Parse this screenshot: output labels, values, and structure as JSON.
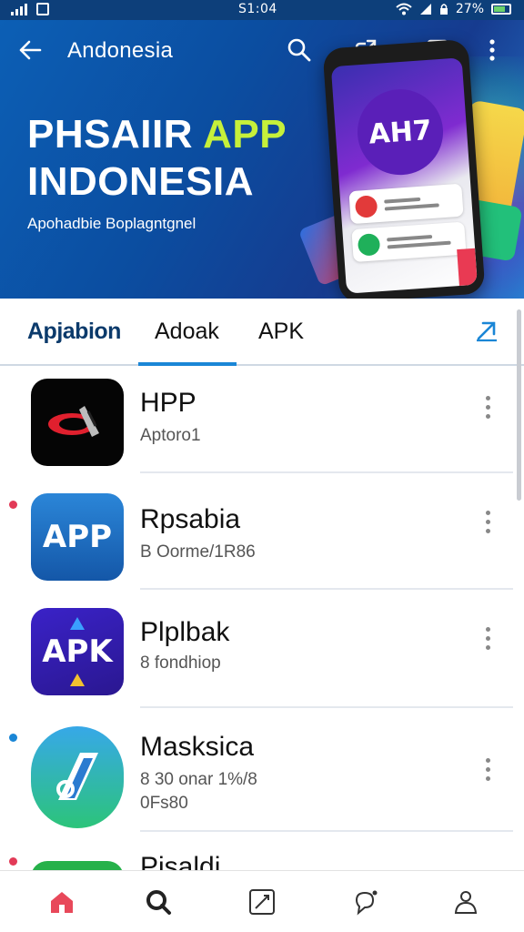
{
  "status_bar": {
    "time": "S1:04",
    "battery": "27%"
  },
  "app_bar": {
    "title": "Andonesia"
  },
  "banner": {
    "title_line1_main": "PHSAIIR",
    "title_line1_accent": "APP",
    "title_line2": "INDONESIA",
    "subtitle": "Apohadbie Boplagntgnel",
    "phone_logo_text": "AH7"
  },
  "tabs": [
    {
      "label": "Apjabion"
    },
    {
      "label": "Adoak"
    },
    {
      "label": "APK"
    }
  ],
  "apps": [
    {
      "name": "HPP",
      "meta": "Aptoro1",
      "meta2": ""
    },
    {
      "name": "Rpsabia",
      "meta": "B Oorme/1R86",
      "meta2": "",
      "icon_text": "APP"
    },
    {
      "name": "Plplbak",
      "meta": "8 fondhiop",
      "meta2": "",
      "icon_text": "APK"
    },
    {
      "name": "Masksica",
      "meta": "8 30 onar 1%/8",
      "meta2": "0Fs80"
    },
    {
      "name": "Pisaldi",
      "meta": "",
      "meta2": ""
    }
  ],
  "bottom_nav": [
    {
      "icon": "home-icon"
    },
    {
      "icon": "search-icon"
    },
    {
      "icon": "edit-icon"
    },
    {
      "icon": "chat-icon"
    },
    {
      "icon": "profile-icon"
    }
  ],
  "colors": {
    "brand_blue": "#0c5fb5",
    "accent_green": "#c6f03a",
    "tab_underline": "#1a86d6",
    "home_active": "#e8485a"
  }
}
